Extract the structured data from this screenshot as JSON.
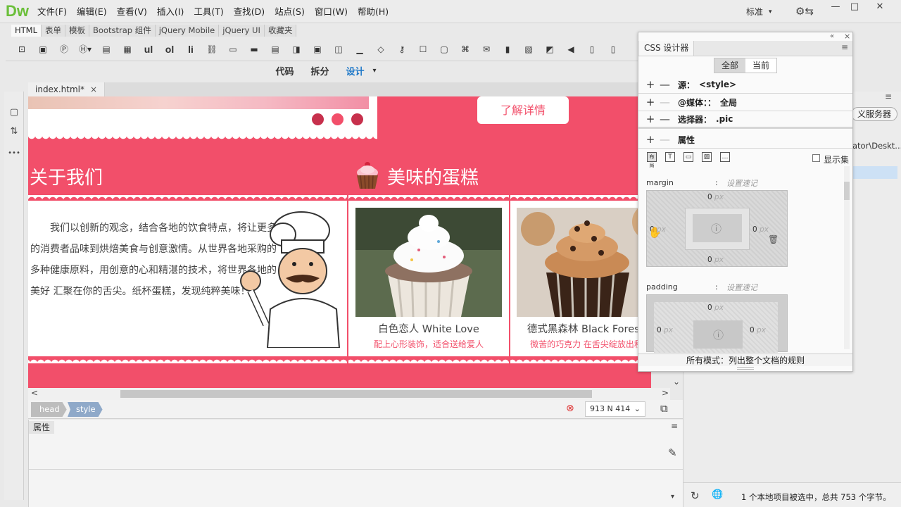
{
  "app": {
    "logo": "Dw",
    "workspace": "标准",
    "workspace_caret": "▾",
    "settings_icon": "⚙⇆"
  },
  "window_controls": {
    "minimize": "—",
    "maximize": "□",
    "close": "✕"
  },
  "menu": [
    "文件(F)",
    "编辑(E)",
    "查看(V)",
    "插入(I)",
    "工具(T)",
    "查找(D)",
    "站点(S)",
    "窗口(W)",
    "帮助(H)"
  ],
  "insert_tabs": [
    "HTML",
    "表单",
    "模板",
    "Bootstrap 组件",
    "jQuery Mobile",
    "jQuery UI",
    "收藏夹"
  ],
  "insert_icons": [
    "div-icon",
    "image-icon",
    "paragraph-icon",
    "heading-icon",
    "table-icon",
    "figure-icon",
    "ul",
    "ol",
    "li",
    "hyperlink-icon",
    "header-icon",
    "nav-icon",
    "main-icon",
    "aside-icon",
    "article-icon",
    "section-icon",
    "footer-icon",
    "meta-icon",
    "keywords-icon",
    "description-icon",
    "viewport-icon",
    "script-icon",
    "email-icon",
    "html5-video-icon",
    "canvas-icon",
    "animate-icon",
    "audio-icon",
    "flash-icon",
    "plugin-icon"
  ],
  "insert_icon_text": {
    "ul": "ul",
    "ol": "ol",
    "li": "li"
  },
  "view_modes": {
    "code": "代码",
    "split": "拆分",
    "design": "设计",
    "caret": "▾"
  },
  "document": {
    "tab_name": "index.html*",
    "tab_close": "×"
  },
  "left_tools": [
    "▢",
    "⇅",
    "•••"
  ],
  "page": {
    "more_button": "了解详情",
    "about_title": "关于我们",
    "cakes_title": "美味的蛋糕",
    "about_text": "我们以创新的观念，结合各地的饮食特点，将让更多的消费者品味到烘焙美食与创意激情。从世界各地采购的多种健康原料，用创意的心和精湛的技术，将世界各地的美好 汇聚在你的舌尖。纸杯蛋糕，发现纯粹美味！",
    "cakes": [
      {
        "name": "白色恋人 White Love",
        "desc": "配上心形装饰，适合送给爱人"
      },
      {
        "name": "德式黑森林 Black Forest C",
        "desc": "微苦的巧克力 在舌尖绽放出秋天"
      }
    ],
    "colors": {
      "brand": "#f24f6a",
      "dot": "#c7304c"
    }
  },
  "status": {
    "tags": [
      "head",
      "style"
    ],
    "error_icon": "⊗",
    "size": "913 N 414",
    "size_caret": "⌄",
    "preview_icon": "⧉",
    "scroll_left": "<",
    "scroll_right": ">",
    "scroll_down": "⌄"
  },
  "properties": {
    "tab": "属性",
    "menu_icon": "≡",
    "edit_icon": "✎",
    "scroll_down": "▾"
  },
  "right_panel": {
    "server_button": "义服务器",
    "path": "ator\\Deskt...",
    "status_text": "1 个本地项目被选中，总共 753 个字节。",
    "refresh_icon": "↻",
    "globe_icon": "🌐",
    "menu_icon": "≡"
  },
  "css_designer": {
    "title": "CSS 设计器",
    "collapse_icon": "«",
    "close_icon": "×",
    "menu_icon": "≡",
    "filter_all": "全部",
    "filter_current": "当前",
    "add": "+",
    "remove": "—",
    "source_label": "源：",
    "source_value": "<style>",
    "media_label": "@媒体：：",
    "media_value": "全局",
    "selector_label": "选择器：",
    "selector_value": ".pic",
    "properties_label": "属性",
    "show_set": "显示集",
    "prop_icons": [
      "布局",
      "T",
      "▭",
      "▨",
      "…"
    ],
    "margin": {
      "name": "margin",
      "colon": ":",
      "shorthand": "设置速记",
      "top": "0",
      "right": "0",
      "bottom": "0",
      "left": "0",
      "unit": "px"
    },
    "padding": {
      "name": "padding",
      "colon": ":",
      "shorthand": "设置速记",
      "top": "0",
      "right": "0",
      "left": "0",
      "unit": "px"
    },
    "lock_icon": "ⓘ",
    "trash_icon": "🗑",
    "footer": "所有模式：列出整个文档的规则"
  }
}
